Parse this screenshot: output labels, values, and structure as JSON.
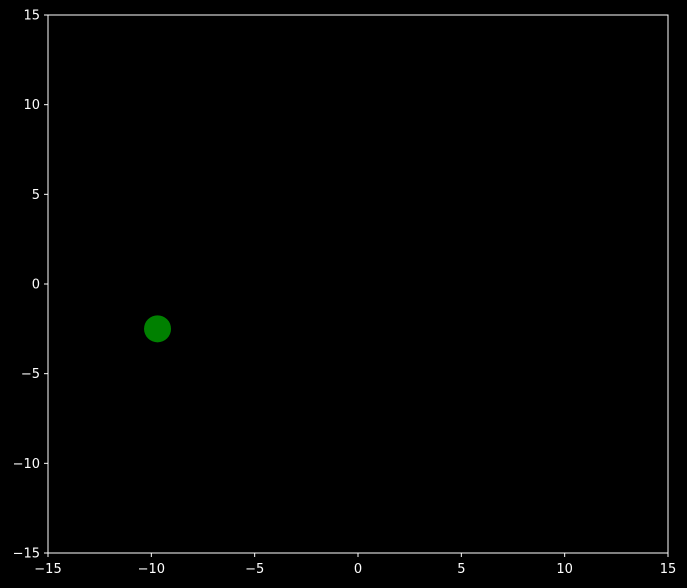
{
  "chart_data": {
    "type": "scatter",
    "title": "",
    "xlabel": "",
    "ylabel": "",
    "xlim": [
      -15,
      15
    ],
    "ylim": [
      -15,
      15
    ],
    "xticks": [
      -15,
      -10,
      -5,
      0,
      5,
      10,
      15
    ],
    "yticks": [
      -15,
      -10,
      -5,
      0,
      5,
      10,
      15
    ],
    "xtick_labels": [
      "−15",
      "−10",
      "−5",
      "0",
      "5",
      "10",
      "15"
    ],
    "ytick_labels": [
      "−15",
      "−10",
      "−5",
      "0",
      "5",
      "10",
      "15"
    ],
    "grid": false,
    "series": [
      {
        "points": [
          {
            "x": -9.7,
            "y": -2.5
          }
        ],
        "color": "#008000"
      }
    ],
    "colors": {
      "background": "#000000",
      "axes": "#ffffff",
      "text": "#ffffff"
    }
  }
}
